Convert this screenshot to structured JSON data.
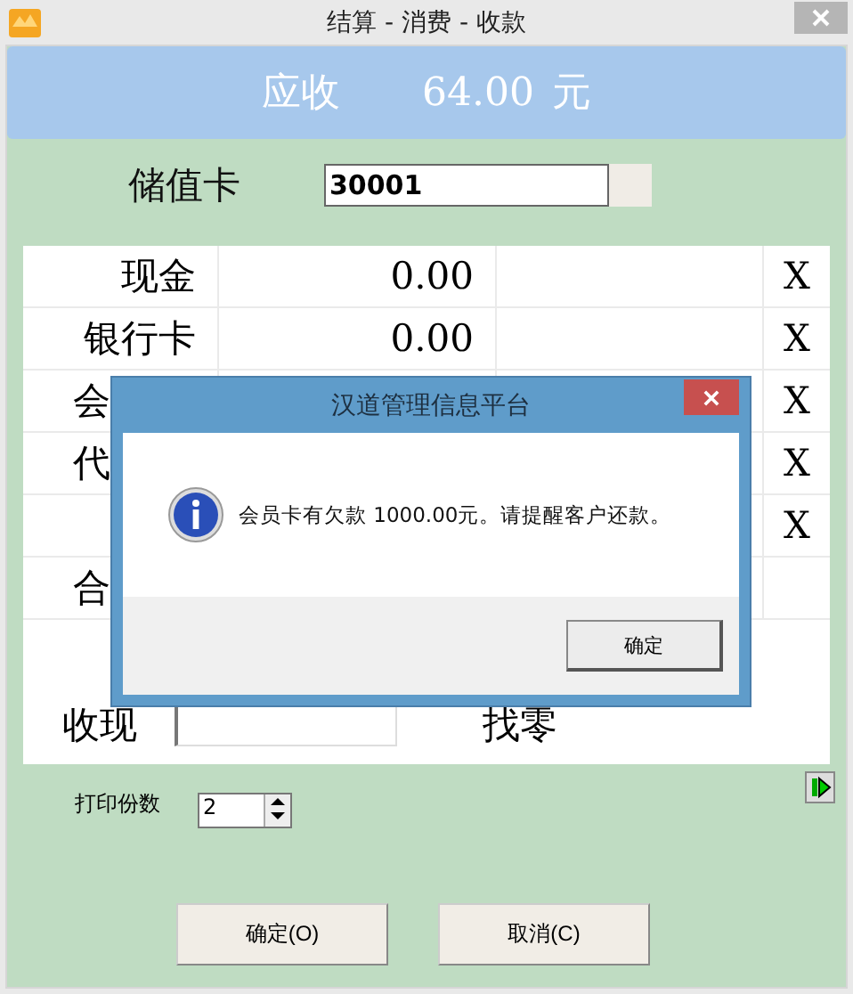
{
  "window": {
    "title": "结算 - 消费 - 收款"
  },
  "header": {
    "label": "应收",
    "amount": "64.00",
    "unit": "元"
  },
  "card": {
    "label": "储值卡",
    "value": "30001"
  },
  "payments": [
    {
      "kind": "full",
      "label": "现金",
      "amount": "0.00",
      "remove": "X"
    },
    {
      "kind": "full",
      "label": "银行卡",
      "amount": "0.00",
      "remove": "X"
    },
    {
      "kind": "covered",
      "label": "会",
      "remove": "X"
    },
    {
      "kind": "covered",
      "label": "代",
      "remove": "X"
    },
    {
      "kind": "full",
      "remove": "X"
    },
    {
      "kind": "covered",
      "label": "合"
    }
  ],
  "cash": {
    "label": "收现"
  },
  "change": {
    "label": "找零"
  },
  "print_copies": {
    "label": "打印份数",
    "value": "2"
  },
  "buttons": [
    "确定(O)",
    "取消(C)"
  ],
  "message_box": {
    "title": "汉道管理信息平台",
    "message": "会员卡有欠款 1000.00元。请提醒客户还款。",
    "button": "确定"
  }
}
